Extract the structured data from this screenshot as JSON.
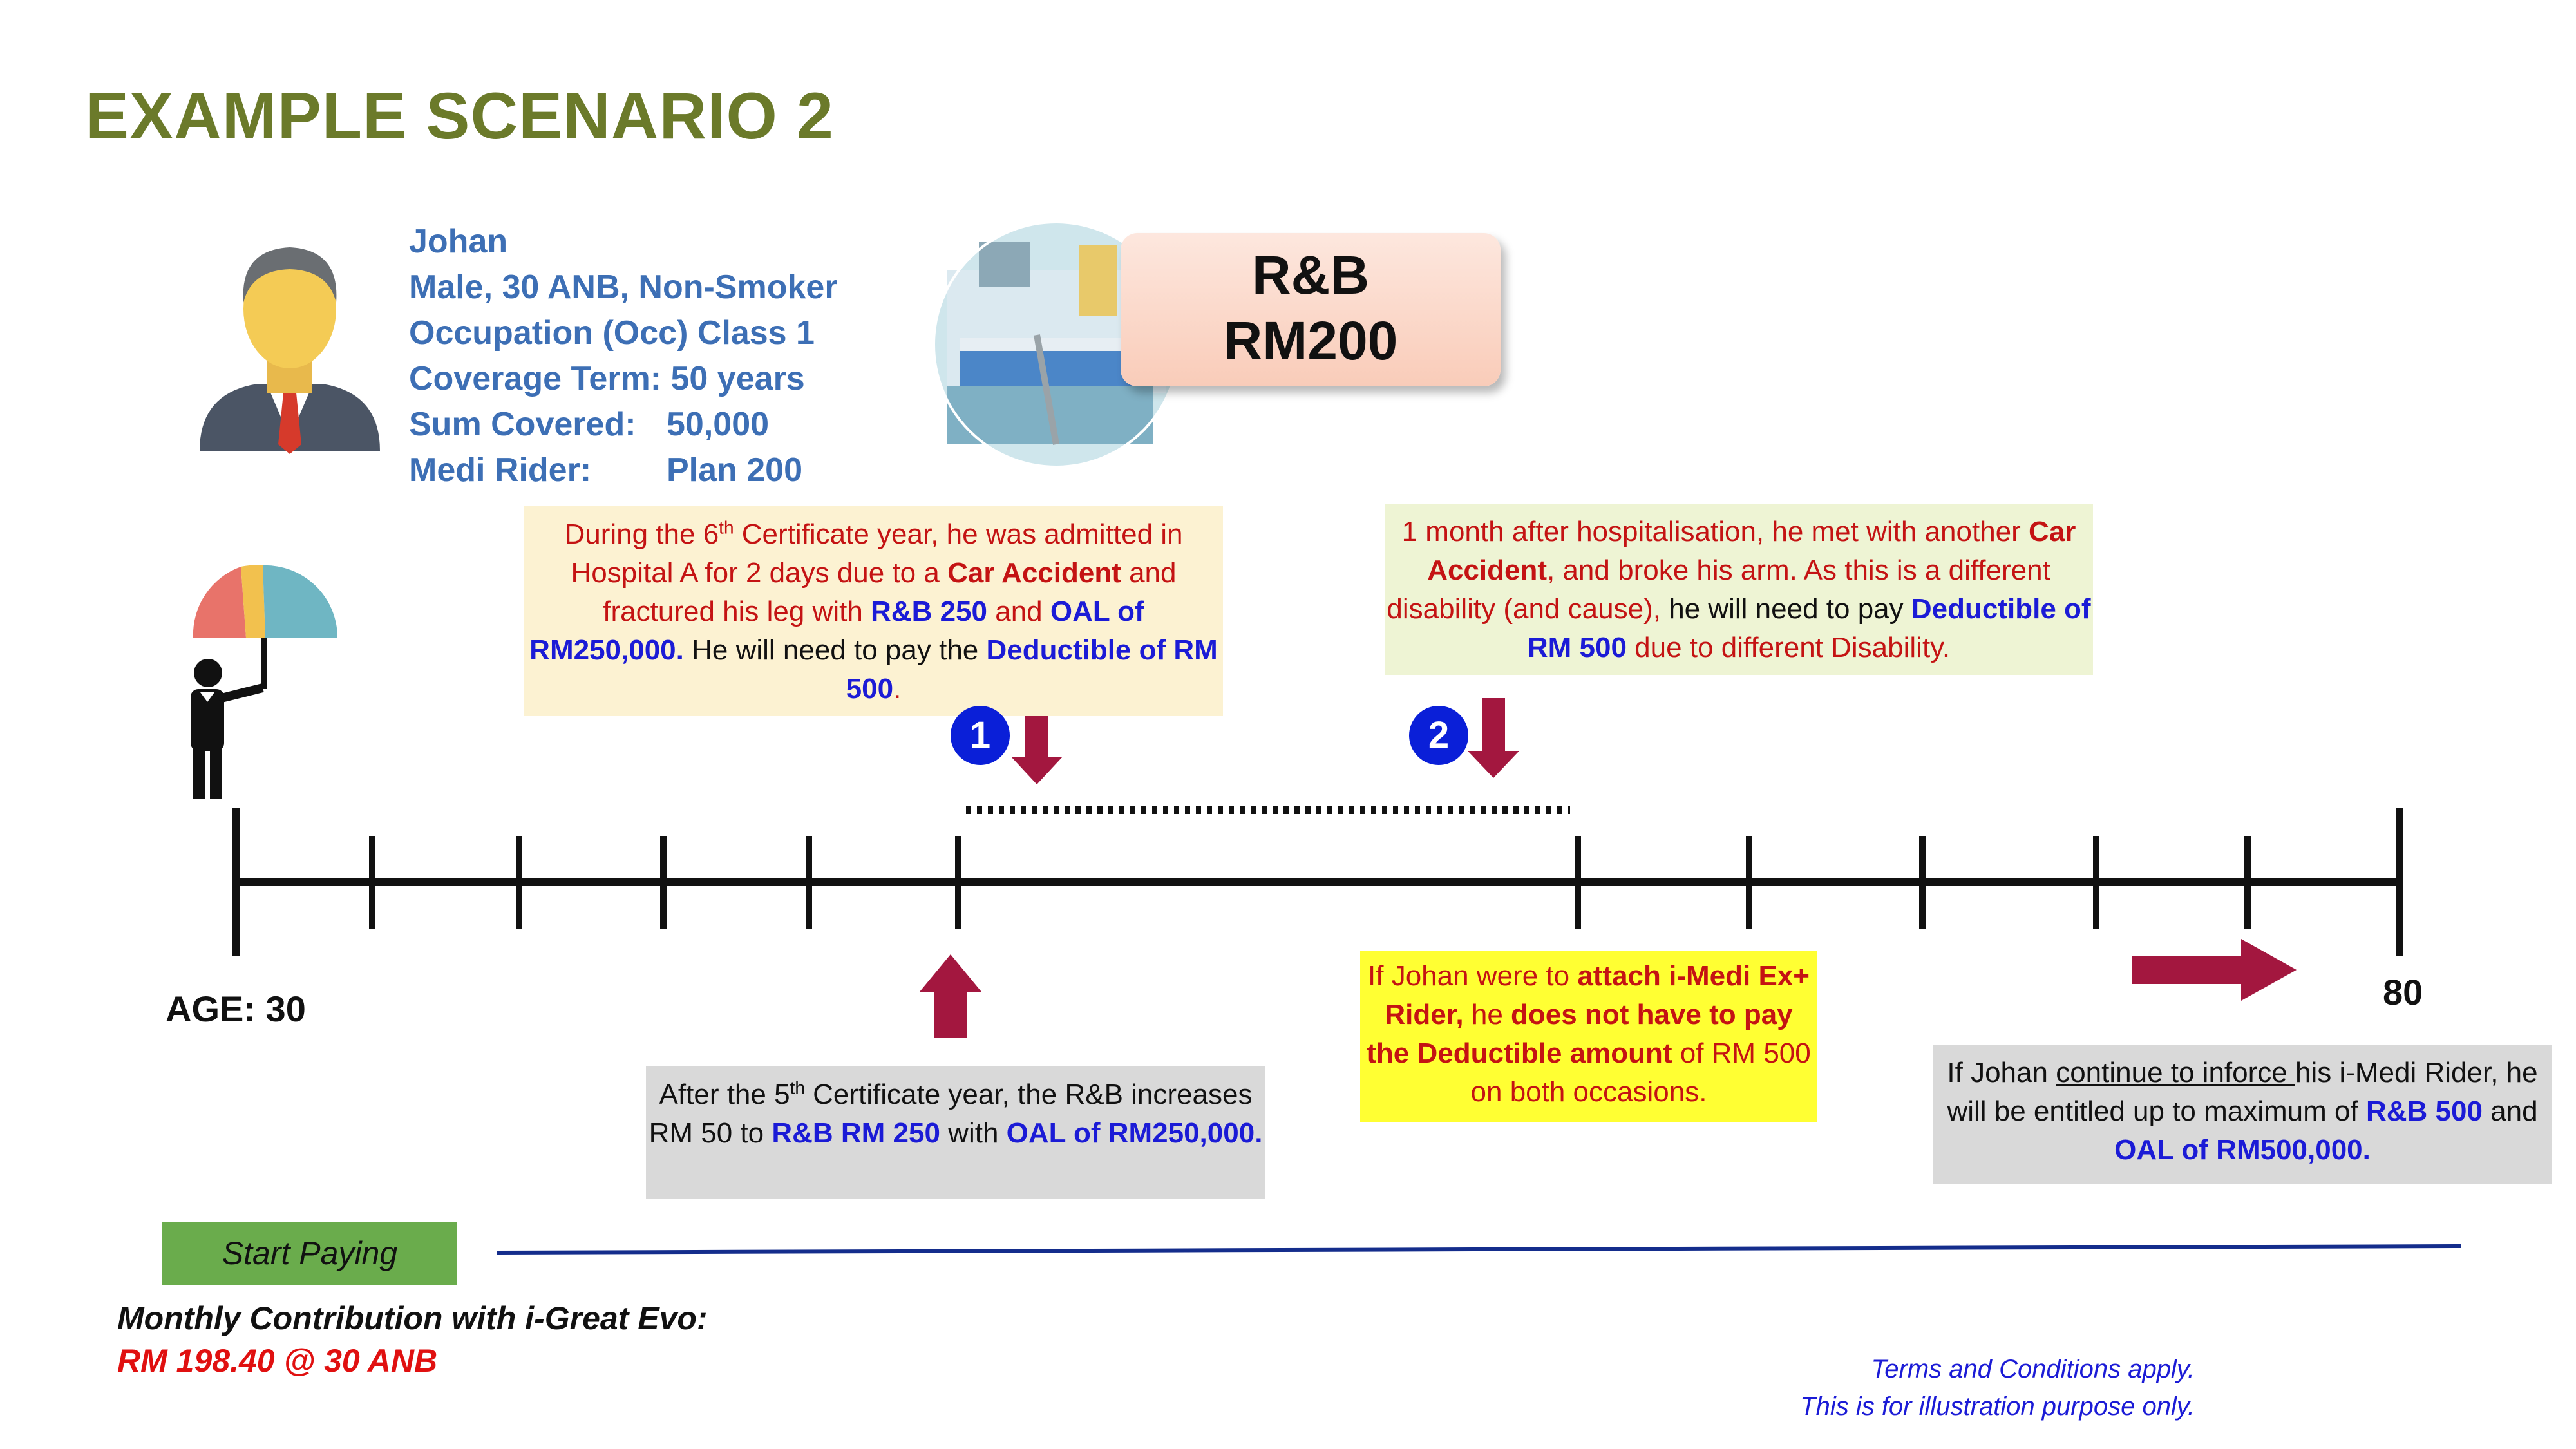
{
  "title": "EXAMPLE SCENARIO 2",
  "profile": {
    "name": "Johan",
    "details": "Male, 30 ANB, Non-Smoker",
    "occupation": "Occupation (Occ) Class 1",
    "coverage_label": "Coverage Term:",
    "coverage_value": "50 years",
    "sum_label": "Sum Covered:",
    "sum_value": "50,000",
    "rider_label": "Medi Rider:",
    "rider_value": "Plan 200"
  },
  "room_board": {
    "line1": "R&B",
    "line2": "RM200"
  },
  "event1": {
    "badge": "1",
    "t1": "During the 6",
    "sup": "th",
    "t2": " Certificate year, he was admitted in Hospital A  for 2 days due to a ",
    "cause": "Car Accident",
    "t3": " and fractured his leg with ",
    "rb": "R&B 250",
    "t4": " and ",
    "oal": "OAL of RM250,000.",
    "t5": "  He will need to pay the ",
    "deductible": "Deductible of RM 500",
    "t6": "."
  },
  "event2": {
    "badge": "2",
    "t1": "1 month after hospitalisation, he met with another ",
    "cause": "Car Accident",
    "t2": ", and broke his arm. As this is a different disability (and cause),",
    "t3": " he will need to pay ",
    "deductible": "Deductible of RM 500",
    "t4": " due to different Disability."
  },
  "increase_note": {
    "t1": "After the 5",
    "sup": "th",
    "t2": " Certificate year, the R&B increases RM 50 to ",
    "rb": "R&B RM 250",
    "t3": " with ",
    "oal": "OAL of RM250,000."
  },
  "ex_rider_note": {
    "t1": "If Johan were to ",
    "b1": "attach i-Medi Ex+ Rider,",
    "t2": " he ",
    "b2": "does not have to pay the Deductible amount",
    "t3": " of RM 500 on both occasions."
  },
  "continue_note": {
    "t1": "If Johan ",
    "u": "continue to inforce ",
    "t2": "his i-Medi Rider, he will be entitled up to maximum of ",
    "rb": "R&B 500",
    "t3": " and ",
    "oal": "OAL of RM500,000."
  },
  "timeline": {
    "start_label": "AGE: 30",
    "end_label": "80"
  },
  "start_paying": "Start Paying",
  "contribution": {
    "label": "Monthly Contribution with i-Great Evo:",
    "value": "RM 198.40 @ 30 ANB"
  },
  "terms": {
    "line1": "Terms and Conditions apply.",
    "line2": "This is for illustration purpose only."
  },
  "colors": {
    "title": "#6b7a2a",
    "profile": "#3d6fb5",
    "badge": "#0a1fd8",
    "arrow": "#a3173f",
    "line_blue": "#142d8c"
  }
}
